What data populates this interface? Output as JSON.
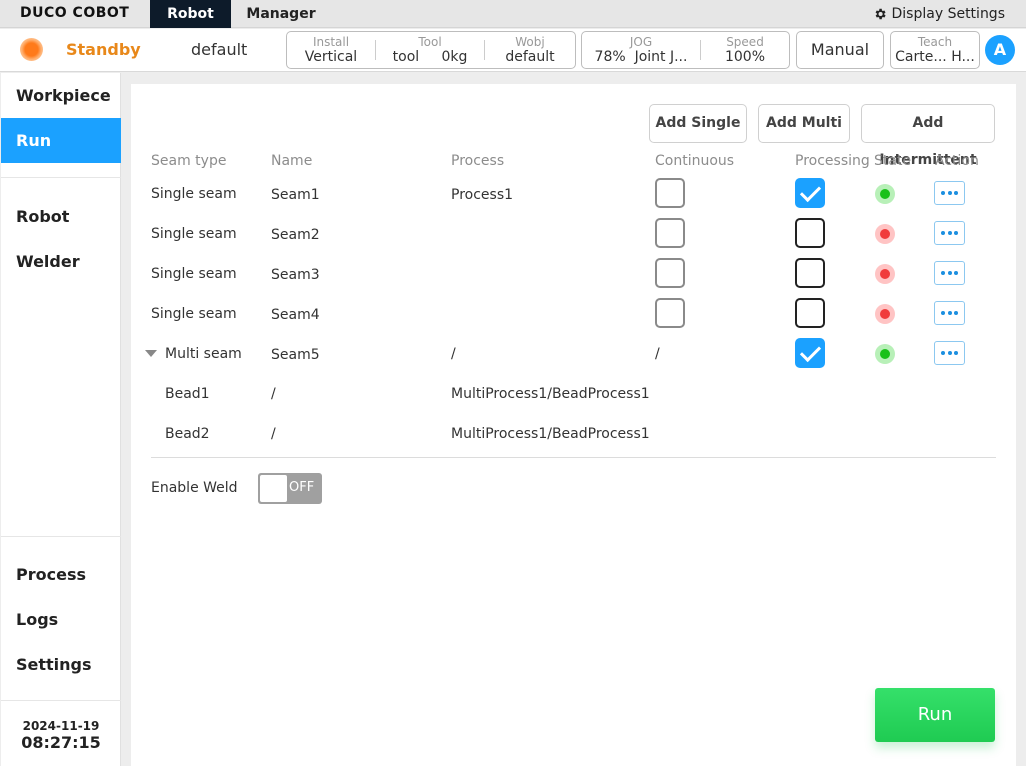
{
  "app": {
    "logo": "DUCO COBOT",
    "tabs": [
      {
        "label": "Robot",
        "active": true
      },
      {
        "label": "Manager",
        "active": false
      }
    ],
    "display_settings": "Display Settings"
  },
  "status": {
    "state": "Standby",
    "state_color": "#e8881a",
    "profile": "default",
    "install": {
      "label": "Install",
      "value": "Vertical"
    },
    "tool": {
      "label": "Tool",
      "value": "tool",
      "weight": "0kg"
    },
    "wobj": {
      "label": "Wobj",
      "value": "default"
    },
    "jog": {
      "label": "JOG",
      "percent": "78%",
      "mode": "Joint J..."
    },
    "speed": {
      "label": "Speed",
      "value": "100%"
    },
    "mode_button": "Manual",
    "teach": {
      "label": "Teach",
      "value": "Carte...",
      "value2": "H..."
    },
    "avatar_letter": "A"
  },
  "sidebar": {
    "items": [
      "Workpiece",
      "Run",
      "Robot",
      "Welder",
      "Process",
      "Logs",
      "Settings"
    ],
    "active": "Run",
    "date": "2024-11-19",
    "time": "08:27:15"
  },
  "toolbar": {
    "add_single": "Add Single",
    "add_multi": "Add Multi",
    "add_intermittent": "Add Intermittent"
  },
  "table": {
    "headers": [
      "Seam type",
      "Name",
      "Process",
      "Continuous",
      "Processing",
      "State",
      "Action"
    ],
    "rows": [
      {
        "seam_type": "Single seam",
        "name": "Seam1",
        "process": "Process1",
        "continuous": false,
        "processing": true,
        "state": "ok"
      },
      {
        "seam_type": "Single seam",
        "name": "Seam2",
        "process": "",
        "continuous": false,
        "processing": false,
        "state": "error"
      },
      {
        "seam_type": "Single seam",
        "name": "Seam3",
        "process": "",
        "continuous": false,
        "processing": false,
        "state": "error"
      },
      {
        "seam_type": "Single seam",
        "name": "Seam4",
        "process": "",
        "continuous": false,
        "processing": false,
        "state": "error"
      },
      {
        "seam_type": "Multi seam",
        "name": "Seam5",
        "process": "/",
        "continuous_text": "/",
        "processing": true,
        "state": "ok",
        "expanded": true
      }
    ],
    "beads": [
      {
        "name": "Bead1",
        "col2": "/",
        "process": "MultiProcess1/BeadProcess1"
      },
      {
        "name": "Bead2",
        "col2": "/",
        "process": "MultiProcess1/BeadProcess1"
      }
    ]
  },
  "enable_weld": {
    "label": "Enable Weld",
    "toggle": "OFF"
  },
  "run_button": "Run",
  "colors": {
    "accent": "#1ba1ff",
    "ok": "#19c119",
    "error": "#f03c3c",
    "run": "#1fcb52",
    "topbar_active": "#0d1b2a"
  }
}
